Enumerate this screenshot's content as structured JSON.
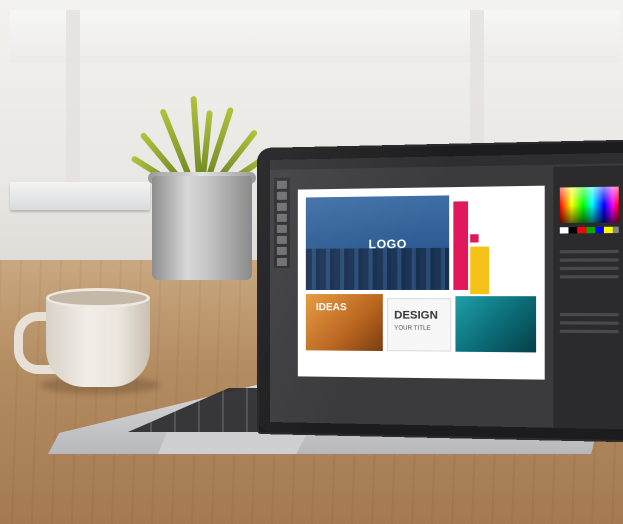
{
  "scene": {
    "description_objects": [
      "potted-plant",
      "coffee-mug",
      "laptop",
      "books"
    ]
  },
  "screen": {
    "logo_label": "LOGO",
    "ideas_label": "IDEAS",
    "design_label": "DESIGN",
    "design_sub": "YOUR TITLE"
  },
  "colors": {
    "accent_pink": "#e0195d",
    "accent_yellow": "#f5c317",
    "city_blue": "#2c5c93",
    "teal": "#0c6f7a"
  }
}
